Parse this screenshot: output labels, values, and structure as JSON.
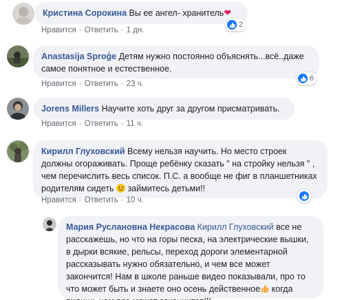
{
  "comments": [
    {
      "author": "Кристина Сорокина",
      "text": "Вы ее ангел- хранитель",
      "like_label": "Нравится",
      "reply_label": "Ответить",
      "time": "1 дн.",
      "reaction_count": "2"
    },
    {
      "author": "Anastasija Sproģe",
      "text": "Детям нужно постоянно объяснять...всё..даже самое понятное и естественное.",
      "like_label": "Нравится",
      "reply_label": "Ответить",
      "time": "23 ч.",
      "reaction_count": "6"
    },
    {
      "author": "Jorens Millers",
      "text": "Научите хоть друг за другом присматривать.",
      "like_label": "Нравится",
      "reply_label": "Ответить",
      "time": "11 ч."
    },
    {
      "author": "Кирилл Глуховский",
      "text_a": "Всему нельзя научить. Но место строек должны огораживать. Проще ребёнку сказать \" на стройку нельзя \" , чем перечислить весь список. П.С. а вообще не фиг в планшетниках родителям сидеть",
      "text_b": "займитесь детьми!!",
      "like_label": "Нравится",
      "reply_label": "Ответить",
      "time": "10 ч."
    }
  ],
  "reply": {
    "author": "Мария Руслановна Некрасова",
    "mention": "Кирилл Глуховский",
    "text_a": "все не расскажешь, но что на горы песка, на электрические вышки, в дырки всякие, рельсы, переход дороги элементарной рассказывать нужно обязательно, и чем все может закончится! Нам в школе раньше видео показывали, про то что может быть и знаете оно осень действенное",
    "text_b": "когда видишь чем все может закончится!!!"
  },
  "colors": {
    "author_link": "#385898",
    "bubble_bg": "#f0f2f5",
    "meta_gray": "#606770",
    "like_blue": "#1877f2"
  },
  "icons": [
    "like-icon",
    "heart-emoji-icon",
    "smile-emoji-icon",
    "thumbs-up-emoji-icon"
  ]
}
